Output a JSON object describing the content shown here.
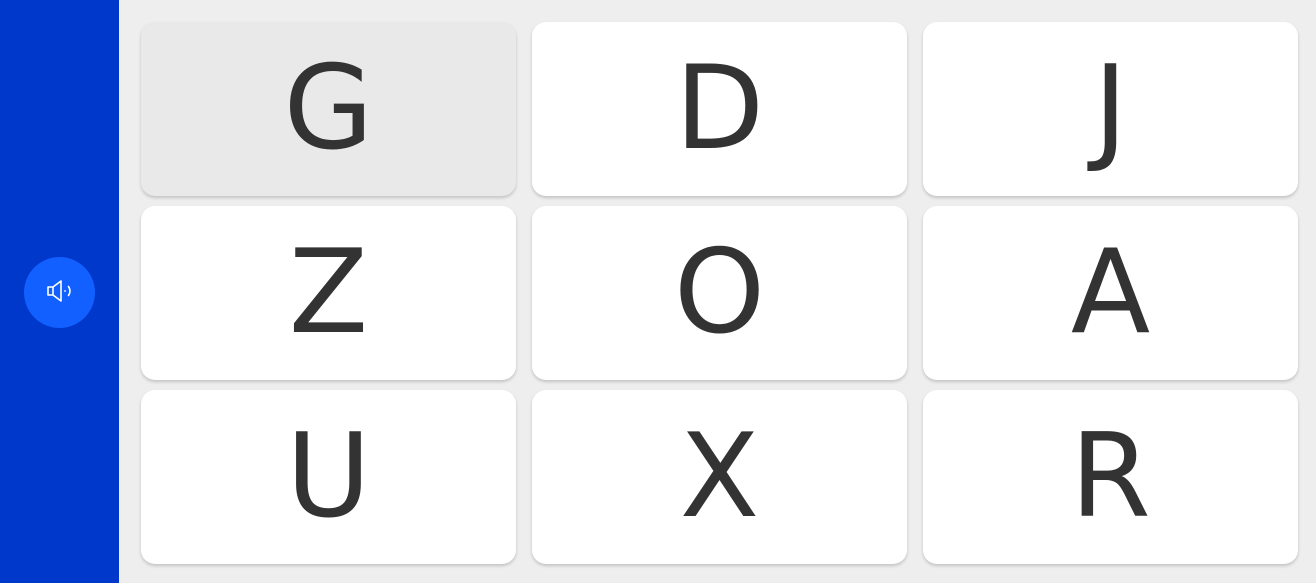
{
  "sidebar": {
    "sound_button": {
      "icon": "speaker-sound-icon",
      "bg_color": "#1160ff"
    },
    "bg_color": "#0038cc"
  },
  "grid": {
    "cards": [
      {
        "letter": "G",
        "selected": true
      },
      {
        "letter": "D",
        "selected": false
      },
      {
        "letter": "J",
        "selected": false
      },
      {
        "letter": "Z",
        "selected": false
      },
      {
        "letter": "O",
        "selected": false
      },
      {
        "letter": "A",
        "selected": false
      },
      {
        "letter": "U",
        "selected": false
      },
      {
        "letter": "X",
        "selected": false
      },
      {
        "letter": "R",
        "selected": false
      }
    ]
  }
}
